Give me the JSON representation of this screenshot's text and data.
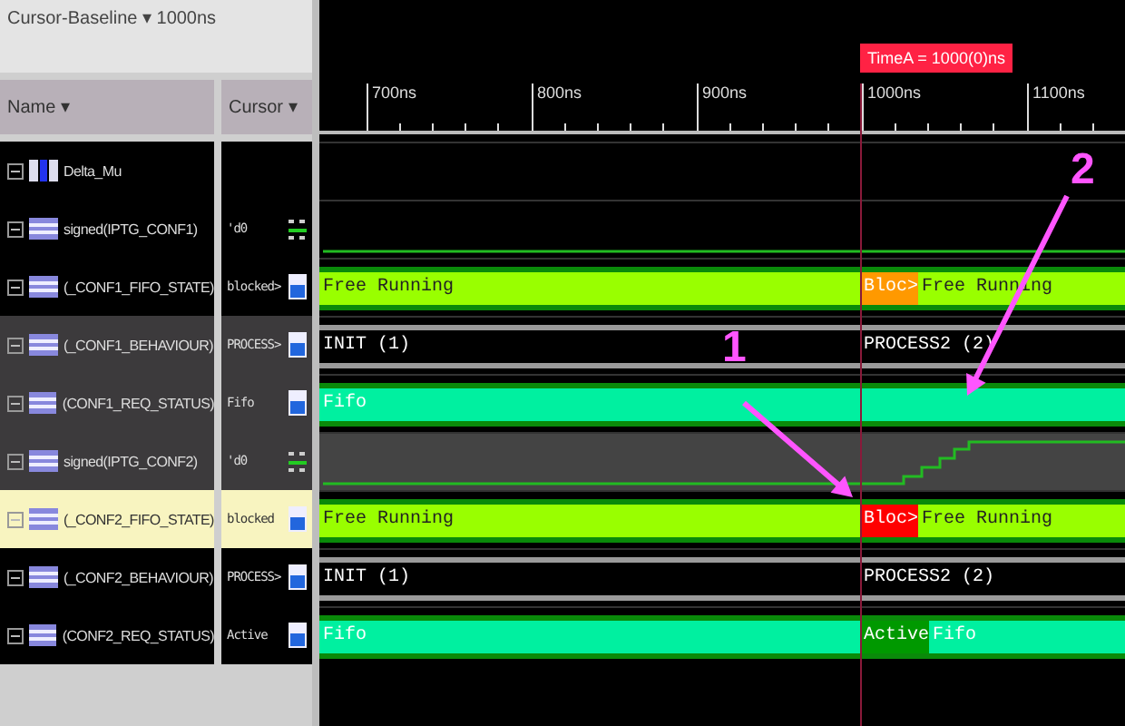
{
  "toolbar": {
    "baseline": "Cursor-Baseline ▾ 1000ns"
  },
  "columns": [
    "Name ▾",
    "Cursor ▾"
  ],
  "ruler": {
    "ticks": [
      "700ns",
      "800ns",
      "900ns",
      "1000ns",
      "1100ns"
    ],
    "cursor_label": "TimeA = 1000(0)ns"
  },
  "signals": [
    {
      "name": "Delta_Mu",
      "kind": "group",
      "highlighted": false,
      "selected": false
    },
    {
      "name": "signed(IPTG_CONF1)",
      "kind": "analog",
      "value": "'d0",
      "staircase": false,
      "highlighted": false,
      "selected": false
    },
    {
      "name": "(_CONF1_FIFO_STATE)",
      "kind": "bus",
      "value": "blocked>",
      "highlighted": false,
      "selected": false,
      "segments": [
        {
          "label": "Free Running",
          "color": "#99ff00"
        },
        {
          "label": "Bloc>",
          "color": "#ff9900"
        },
        {
          "label": "Free Running",
          "color": "#99ff00"
        }
      ]
    },
    {
      "name": "(_CONF1_BEHAVIOUR)",
      "kind": "bus",
      "value": "PROCESS>",
      "highlighted": true,
      "selected": false,
      "segments": [
        {
          "label": "INIT (1)",
          "color": "#000000"
        },
        {
          "label": "PROCESS2 (2)",
          "color": "#000000"
        }
      ]
    },
    {
      "name": "(CONF1_REQ_STATUS)",
      "kind": "bus",
      "value": "Fifo",
      "highlighted": true,
      "selected": false,
      "segments": [
        {
          "label": "Fifo",
          "color": "#00f0a0"
        }
      ]
    },
    {
      "name": "signed(IPTG_CONF2)",
      "kind": "analog",
      "value": "'d0",
      "staircase": true,
      "highlighted": true,
      "selected": false
    },
    {
      "name": "(_CONF2_FIFO_STATE)",
      "kind": "bus",
      "value": "blocked",
      "highlighted": false,
      "selected": true,
      "segments": [
        {
          "label": "Free Running",
          "color": "#99ff00"
        },
        {
          "label": "Bloc>",
          "color": "#ff0000"
        },
        {
          "label": "Free Running",
          "color": "#99ff00"
        }
      ]
    },
    {
      "name": "(_CONF2_BEHAVIOUR)",
      "kind": "bus",
      "value": "PROCESS>",
      "highlighted": false,
      "selected": false,
      "segments": [
        {
          "label": "INIT (1)",
          "color": "#000000"
        },
        {
          "label": "PROCESS2 (2)",
          "color": "#000000"
        }
      ]
    },
    {
      "name": "(CONF2_REQ_STATUS)",
      "kind": "bus",
      "value": "Active",
      "highlighted": false,
      "selected": false,
      "segments": [
        {
          "label": "Fifo",
          "color": "#00f0a0"
        },
        {
          "label": "Active",
          "color": "#009900"
        },
        {
          "label": "Fifo",
          "color": "#00f0a0"
        }
      ]
    }
  ],
  "annotations": [
    {
      "label": "1"
    },
    {
      "label": "2"
    }
  ]
}
